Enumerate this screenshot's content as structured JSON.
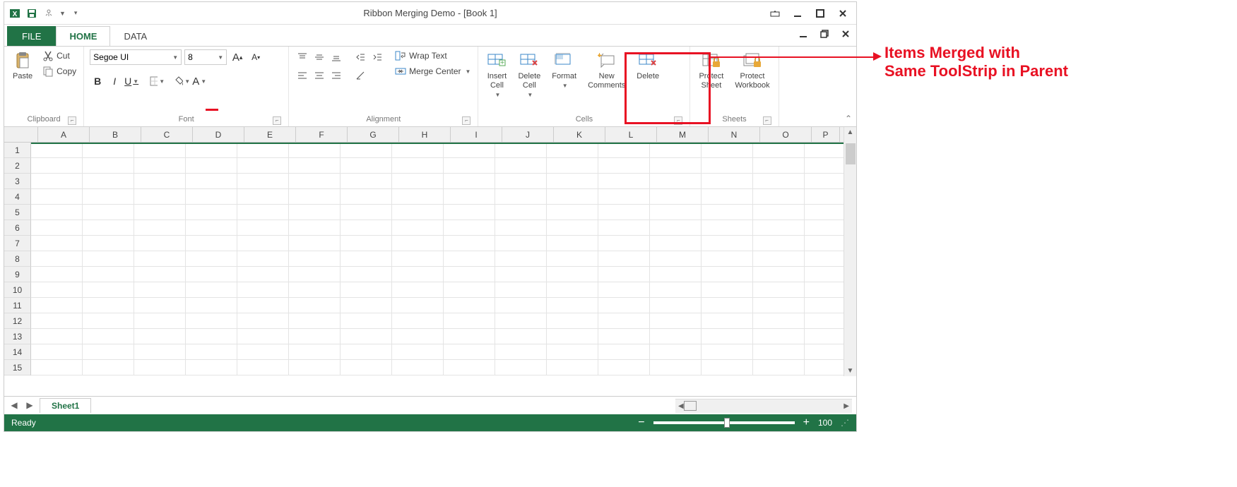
{
  "title": "Ribbon Merging Demo - [Book 1]",
  "tabs": {
    "file": "FILE",
    "home": "HOME",
    "data": "DATA"
  },
  "clipboard": {
    "paste": "Paste",
    "cut": "Cut",
    "copy": "Copy",
    "label": "Clipboard"
  },
  "font": {
    "name": "Segoe UI",
    "size": "8",
    "label": "Font"
  },
  "alignment": {
    "wrap": "Wrap Text",
    "merge": "Merge Center",
    "label": "Alignment"
  },
  "cells": {
    "insert": "Insert\nCell",
    "delete": "Delete\nCell",
    "format": "Format",
    "newc": "New\nComments",
    "del2": "Delete",
    "label": "Cells"
  },
  "sheets": {
    "psheet": "Protect\nSheet",
    "pwb": "Protect\nWorkbook",
    "label": "Sheets"
  },
  "columns": [
    "A",
    "B",
    "C",
    "D",
    "E",
    "F",
    "G",
    "H",
    "I",
    "J",
    "K",
    "L",
    "M",
    "N",
    "O",
    "P"
  ],
  "rows": [
    "1",
    "2",
    "3",
    "4",
    "5",
    "6",
    "7",
    "8",
    "9",
    "10",
    "11",
    "12",
    "13",
    "14",
    "15"
  ],
  "sheettab": "Sheet1",
  "status": {
    "ready": "Ready",
    "zoom": "100"
  },
  "callout": "Items Merged with\nSame ToolStrip in Parent"
}
